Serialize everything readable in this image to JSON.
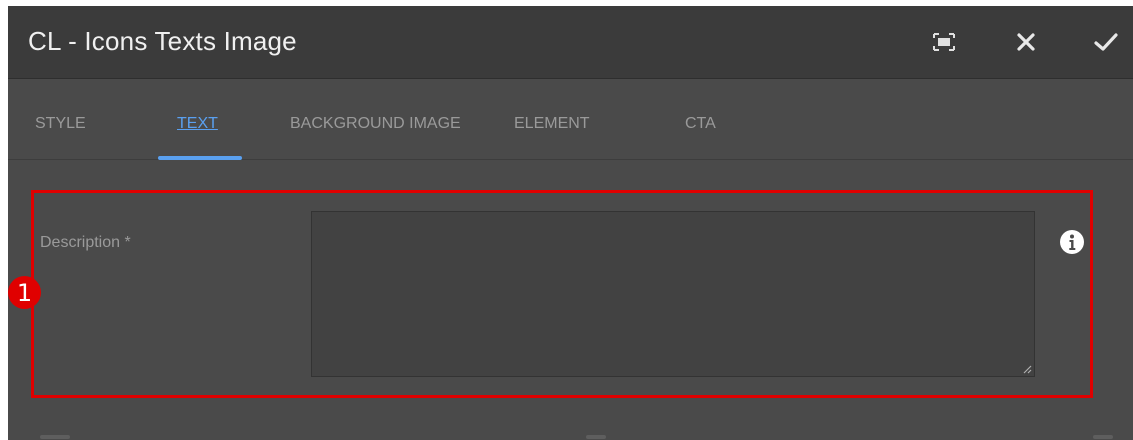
{
  "dialog": {
    "title": "CL - Icons Texts Image",
    "actions": {
      "fullscreen_icon": "fullscreen-icon",
      "close_icon": "close-icon",
      "done_icon": "checkmark-icon"
    }
  },
  "tabs": [
    {
      "label": "STYLE",
      "active": false
    },
    {
      "label": "TEXT",
      "active": true
    },
    {
      "label": "BACKGROUND IMAGE",
      "active": false
    },
    {
      "label": "ELEMENT",
      "active": false
    },
    {
      "label": "CTA",
      "active": false
    }
  ],
  "description_field": {
    "label": "Description *",
    "value": "",
    "info_icon": "info-icon"
  },
  "annotation": {
    "number": "1",
    "color": "#e00000"
  },
  "colors": {
    "accent": "#5aa0f0",
    "dialog_bg": "#4a4a4a",
    "titlebar_bg": "#3b3b3b"
  }
}
